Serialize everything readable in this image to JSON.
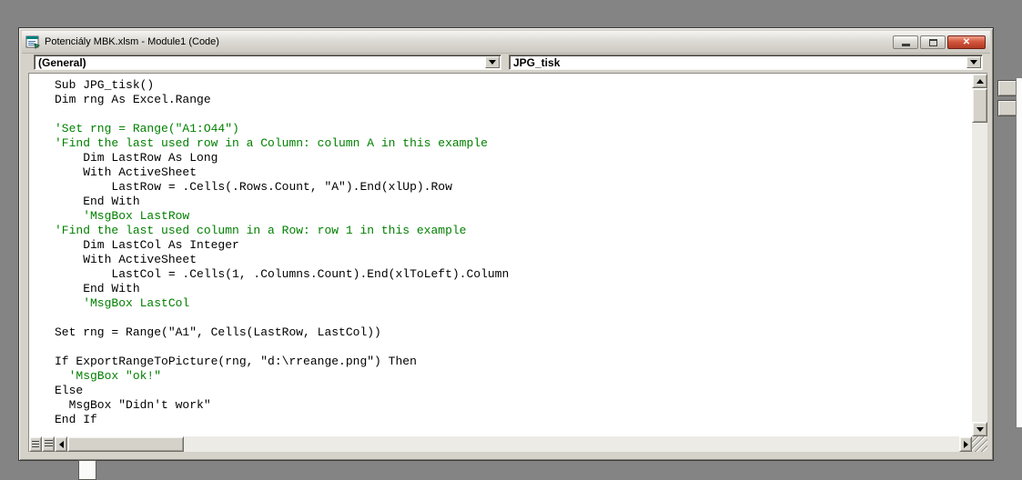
{
  "window": {
    "title": "Potenciály MBK.xlsm - Module1 (Code)"
  },
  "toolbar": {
    "object_dropdown": {
      "value": "(General)"
    },
    "procedure_dropdown": {
      "value": "JPG_tisk"
    }
  },
  "icons": {
    "close_glyph": "✕",
    "minimize": "minimize-bar",
    "maximize": "maximize-box",
    "dropdown_arrow": "▼",
    "scroll_up": "▲",
    "scroll_down": "▼",
    "scroll_left": "◄",
    "scroll_right": "►"
  },
  "colors": {
    "comment_green": "#008000",
    "code_text": "#000000",
    "window_chrome": "#d5d2ca",
    "close_button_red": "#c0452e",
    "desktop_gray": "#848484",
    "code_background": "#ffffff"
  },
  "code": {
    "lines": [
      {
        "type": "code",
        "text": "Sub JPG_tisk()"
      },
      {
        "type": "code",
        "text": "Dim rng As Excel.Range"
      },
      {
        "type": "blank",
        "text": ""
      },
      {
        "type": "comment",
        "text": "'Set rng = Range(\"A1:O44\")"
      },
      {
        "type": "comment",
        "text": "'Find the last used row in a Column: column A in this example"
      },
      {
        "type": "code",
        "text": "    Dim LastRow As Long"
      },
      {
        "type": "code",
        "text": "    With ActiveSheet"
      },
      {
        "type": "code",
        "text": "        LastRow = .Cells(.Rows.Count, \"A\").End(xlUp).Row"
      },
      {
        "type": "code",
        "text": "    End With"
      },
      {
        "type": "comment",
        "text": "    'MsgBox LastRow"
      },
      {
        "type": "comment",
        "text": "'Find the last used column in a Row: row 1 in this example"
      },
      {
        "type": "code",
        "text": "    Dim LastCol As Integer"
      },
      {
        "type": "code",
        "text": "    With ActiveSheet"
      },
      {
        "type": "code",
        "text": "        LastCol = .Cells(1, .Columns.Count).End(xlToLeft).Column"
      },
      {
        "type": "code",
        "text": "    End With"
      },
      {
        "type": "comment",
        "text": "    'MsgBox LastCol"
      },
      {
        "type": "blank",
        "text": ""
      },
      {
        "type": "code",
        "text": "Set rng = Range(\"A1\", Cells(LastRow, LastCol))"
      },
      {
        "type": "blank",
        "text": ""
      },
      {
        "type": "code",
        "text": "If ExportRangeToPicture(rng, \"d:\\rreange.png\") Then"
      },
      {
        "type": "comment",
        "text": "  'MsgBox \"ok!\""
      },
      {
        "type": "code",
        "text": "Else"
      },
      {
        "type": "code",
        "text": "  MsgBox \"Didn't work\""
      },
      {
        "type": "code",
        "text": "End If"
      }
    ]
  }
}
